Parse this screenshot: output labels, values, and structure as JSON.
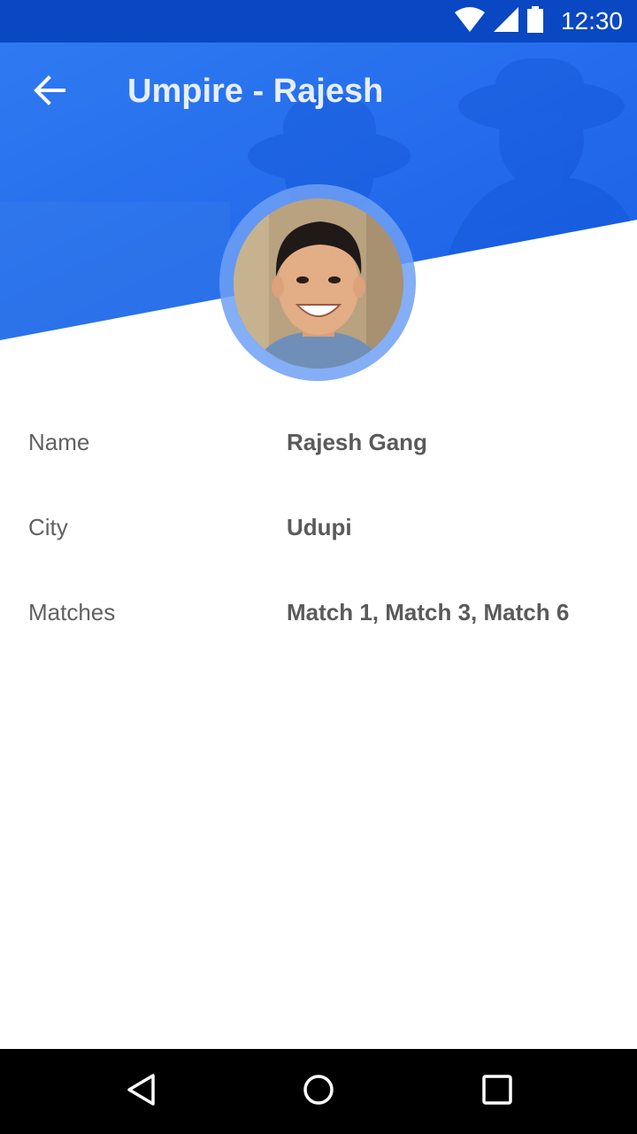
{
  "status_bar": {
    "time": "12:30",
    "icons": [
      "wifi-icon",
      "cellular-signal-icon",
      "battery-icon"
    ]
  },
  "app_bar": {
    "title": "Umpire - Rajesh",
    "back_icon": "arrow-back-icon"
  },
  "profile": {
    "avatar": "profile-photo"
  },
  "details": [
    {
      "label": "Name",
      "value": "Rajesh Gang"
    },
    {
      "label": "City",
      "value": "Udupi"
    },
    {
      "label": "Matches",
      "value": "Match 1, Match 3, Match 6"
    }
  ],
  "nav_bar": {
    "icons": [
      "back-triangle-icon",
      "home-circle-icon",
      "recents-square-icon"
    ]
  },
  "colors": {
    "primary": "#2a74f0",
    "status_bar": "#0a47c2",
    "label_text": "#616161",
    "value_text": "#5a5a5a"
  }
}
